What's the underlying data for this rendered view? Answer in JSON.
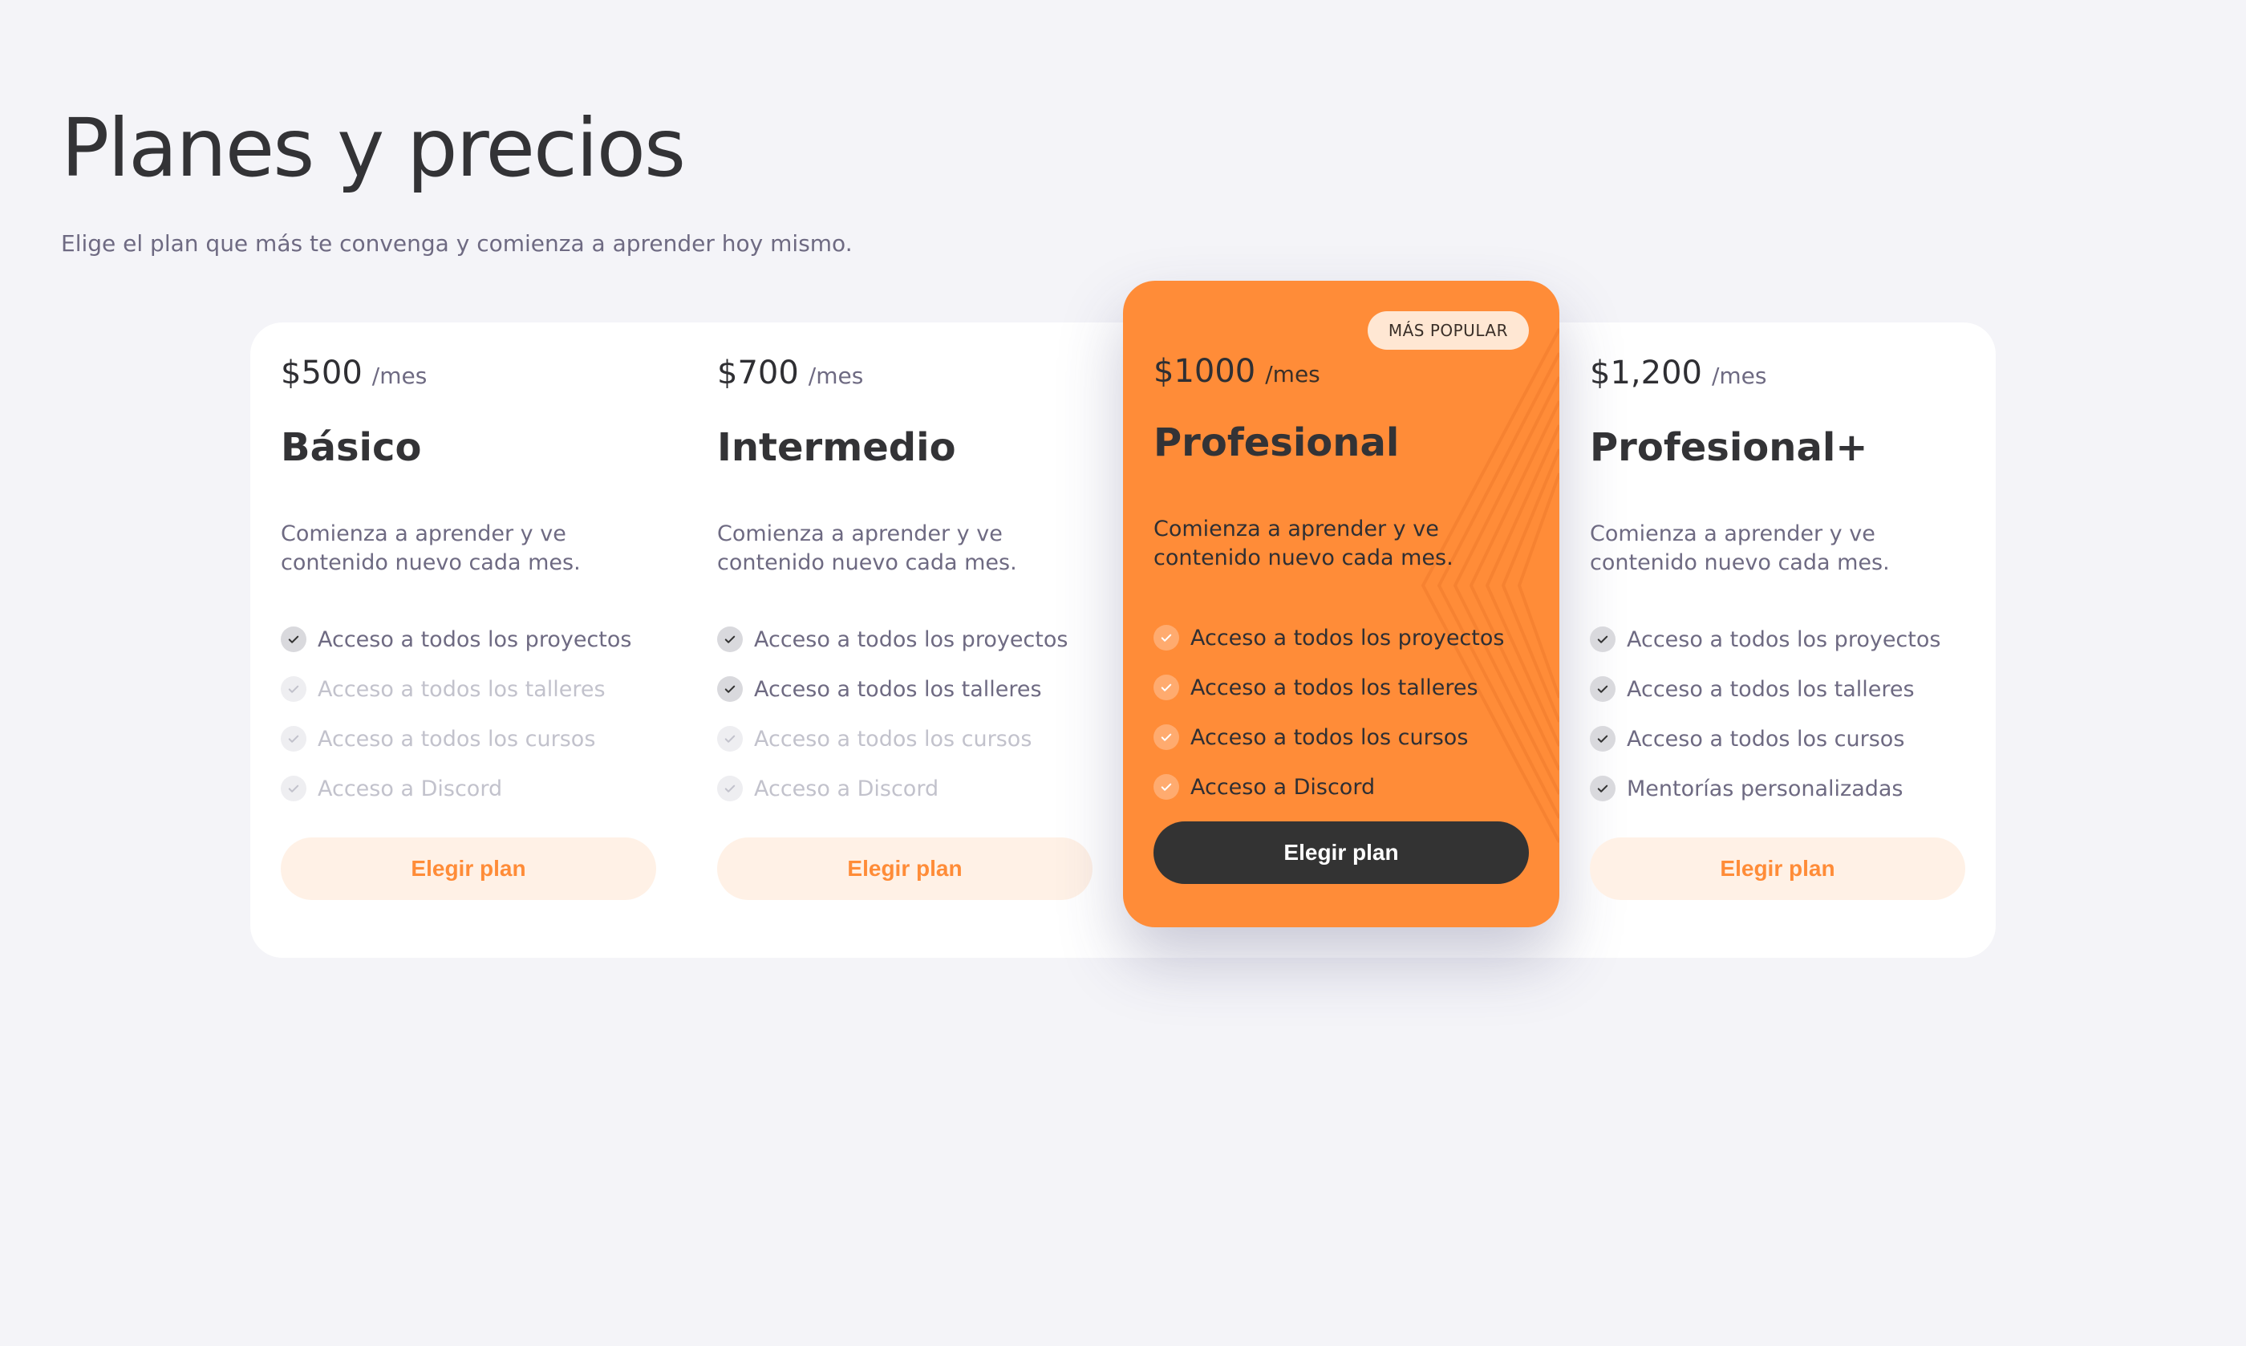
{
  "header": {
    "title": "Planes y precios",
    "subtitle": "Elige el plan que más te convenga y comienza a aprender hoy mismo."
  },
  "colors": {
    "accent": "#ff8c38",
    "background": "#f4f4f8",
    "dark": "#333333"
  },
  "plans": [
    {
      "price": "$500",
      "period": "/mes",
      "name": "Básico",
      "description": "Comienza a aprender y ve contenido nuevo cada mes.",
      "features": [
        {
          "label": "Acceso a todos los proyectos",
          "enabled": true
        },
        {
          "label": "Acceso a todos los talleres",
          "enabled": false
        },
        {
          "label": "Acceso a todos los cursos",
          "enabled": false
        },
        {
          "label": "Acceso a Discord",
          "enabled": false
        }
      ],
      "button": "Elegir plan"
    },
    {
      "price": "$700",
      "period": "/mes",
      "name": "Intermedio",
      "description": "Comienza a aprender y ve contenido nuevo cada mes.",
      "features": [
        {
          "label": "Acceso a todos los proyectos",
          "enabled": true
        },
        {
          "label": "Acceso a todos los talleres",
          "enabled": true
        },
        {
          "label": "Acceso a todos los cursos",
          "enabled": false
        },
        {
          "label": "Acceso a Discord",
          "enabled": false
        }
      ],
      "button": "Elegir plan"
    },
    {
      "badge": "MÁS POPULAR",
      "price": "$1000",
      "period": "/mes",
      "name": "Profesional",
      "description": "Comienza a aprender y ve contenido nuevo cada mes.",
      "features": [
        {
          "label": "Acceso a todos los proyectos",
          "enabled": true
        },
        {
          "label": "Acceso a todos los talleres",
          "enabled": true
        },
        {
          "label": "Acceso a todos los cursos",
          "enabled": true
        },
        {
          "label": "Acceso a Discord",
          "enabled": true
        }
      ],
      "button": "Elegir plan"
    },
    {
      "price": "$1,200",
      "period": "/mes",
      "name": "Profesional+",
      "description": "Comienza a aprender y ve contenido nuevo cada mes.",
      "features": [
        {
          "label": "Acceso a todos los proyectos",
          "enabled": true
        },
        {
          "label": "Acceso a todos los talleres",
          "enabled": true
        },
        {
          "label": "Acceso a todos los cursos",
          "enabled": true
        },
        {
          "label": "Mentorías personalizadas",
          "enabled": true
        }
      ],
      "button": "Elegir plan"
    }
  ]
}
